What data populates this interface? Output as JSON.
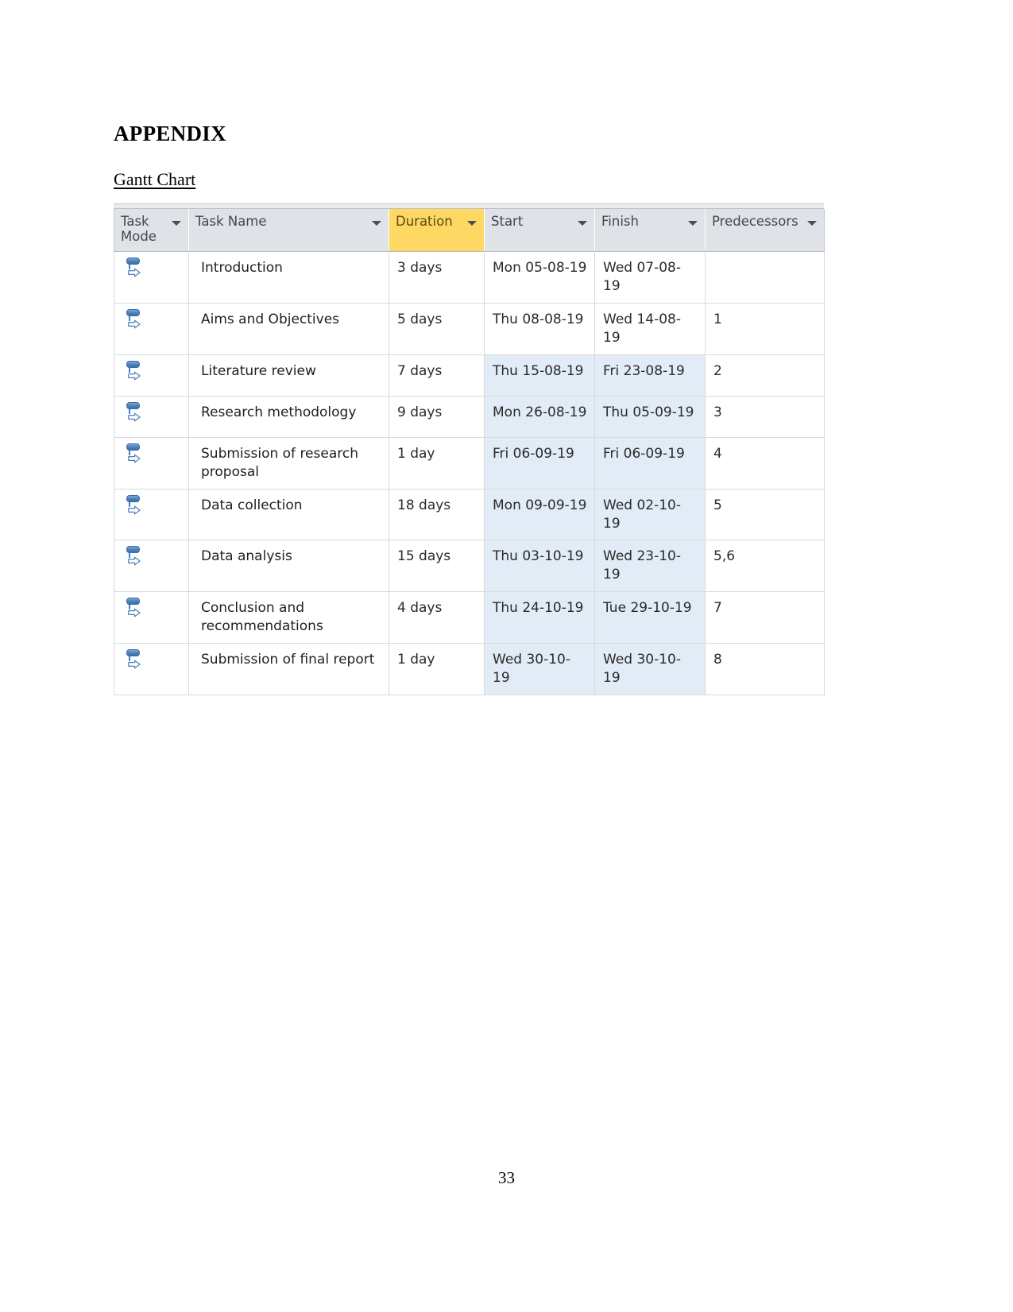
{
  "document": {
    "title": "APPENDIX",
    "section_label": "Gantt Chart ",
    "page_number": "33"
  },
  "table": {
    "headers": [
      {
        "label": "Task Mode",
        "key": "task_mode",
        "highlighted": false
      },
      {
        "label": "Task Name",
        "key": "task_name",
        "highlighted": false
      },
      {
        "label": "Duration",
        "key": "duration",
        "highlighted": true
      },
      {
        "label": "Start",
        "key": "start",
        "highlighted": false
      },
      {
        "label": "Finish",
        "key": "finish",
        "highlighted": false
      },
      {
        "label": "Predecessors",
        "key": "predecessors",
        "highlighted": false
      }
    ],
    "header_highlight_color": "#ffd864",
    "header_background_color": "#dfe2e6",
    "selection_color": "#e2ecf7",
    "task_mode_icon": "auto-scheduled-icon",
    "rows": [
      {
        "task_mode": "auto-scheduled-icon",
        "task_name": "Introduction",
        "duration": "3 days",
        "start": "Mon 05-08-19",
        "finish": "Wed 07-08-19",
        "predecessors": "",
        "selected": false
      },
      {
        "task_mode": "auto-scheduled-icon",
        "task_name": "Aims and Objectives",
        "duration": "5 days",
        "start": "Thu 08-08-19",
        "finish": "Wed 14-08-19",
        "predecessors": "1",
        "selected": false
      },
      {
        "task_mode": "auto-scheduled-icon",
        "task_name": "Literature review",
        "duration": "7 days",
        "start": "Thu 15-08-19",
        "finish": "Fri 23-08-19",
        "predecessors": "2",
        "selected": true
      },
      {
        "task_mode": "auto-scheduled-icon",
        "task_name": "Research methodology",
        "duration": "9 days",
        "start": "Mon 26-08-19",
        "finish": "Thu 05-09-19",
        "predecessors": "3",
        "selected": true
      },
      {
        "task_mode": "auto-scheduled-icon",
        "task_name": "Submission of research proposal",
        "duration": "1 day",
        "start": "Fri 06-09-19",
        "finish": "Fri 06-09-19",
        "predecessors": "4",
        "selected": true
      },
      {
        "task_mode": "auto-scheduled-icon",
        "task_name": "Data collection",
        "duration": "18 days",
        "start": "Mon 09-09-19",
        "finish": "Wed 02-10-19",
        "predecessors": "5",
        "selected": true
      },
      {
        "task_mode": "auto-scheduled-icon",
        "task_name": "Data analysis",
        "duration": "15 days",
        "start": "Thu 03-10-19",
        "finish": "Wed 23-10-19",
        "predecessors": "5,6",
        "selected": true
      },
      {
        "task_mode": "auto-scheduled-icon",
        "task_name": "Conclusion and recommendations",
        "duration": "4 days",
        "start": "Thu 24-10-19",
        "finish": "Tue 29-10-19",
        "predecessors": "7",
        "selected": true
      },
      {
        "task_mode": "auto-scheduled-icon",
        "task_name": "Submission of final report",
        "duration": "1 day",
        "start": "Wed 30-10-19",
        "finish": "Wed 30-10-19",
        "predecessors": "8",
        "selected": true
      }
    ]
  }
}
